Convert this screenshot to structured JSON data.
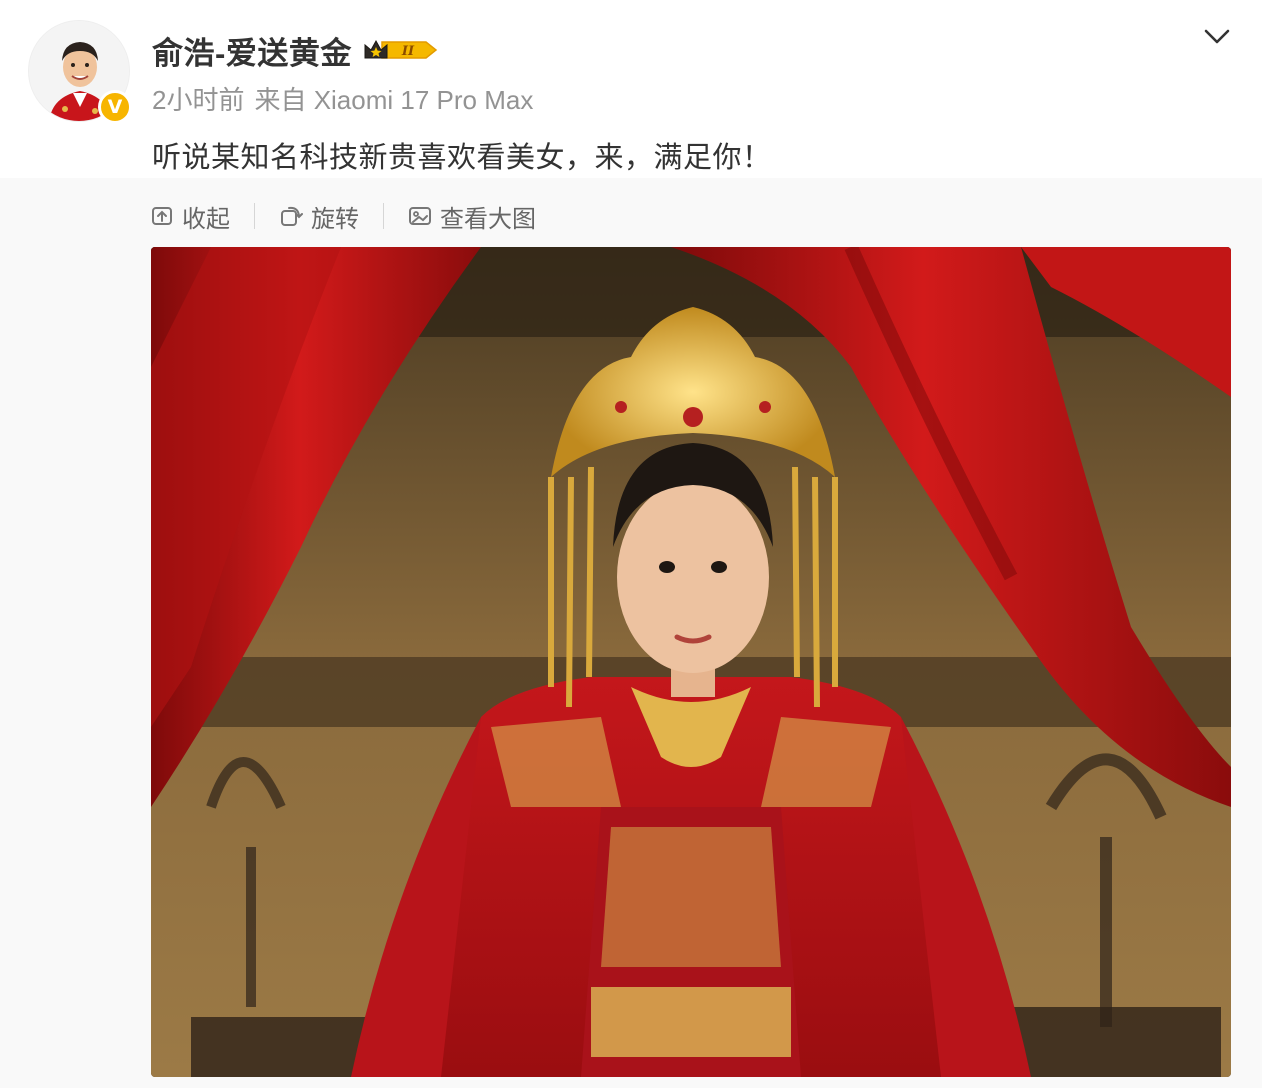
{
  "post": {
    "author": {
      "name": "俞浩-爱送黄金",
      "verified_icon": "verified-v-badge",
      "verified_mark": "V",
      "level_icon": "crown-level-badge",
      "level_mark": "II"
    },
    "meta": {
      "time": "2小时前",
      "source": "来自 Xiaomi 17 Pro Max"
    },
    "text": "听说某知名科技新贵喜欢看美女，来，满足你！",
    "menu_icon": "chevron-down-icon"
  },
  "toolbar": {
    "collapse_label": "收起",
    "rotate_label": "旋转",
    "view_large_label": "查看大图",
    "collapse_icon": "collapse-icon",
    "rotate_icon": "rotate-icon",
    "view_large_icon": "image-icon"
  },
  "image": {
    "subject": "woman in red bridal robe with gold phoenix crown before red curtains"
  },
  "colors": {
    "name_text": "#333333",
    "meta_text": "#939393",
    "toolbar_text": "#666666",
    "verified_badge": "#f7b500",
    "level_badge": "#f5b800",
    "media_background": "#f9f9f9"
  }
}
